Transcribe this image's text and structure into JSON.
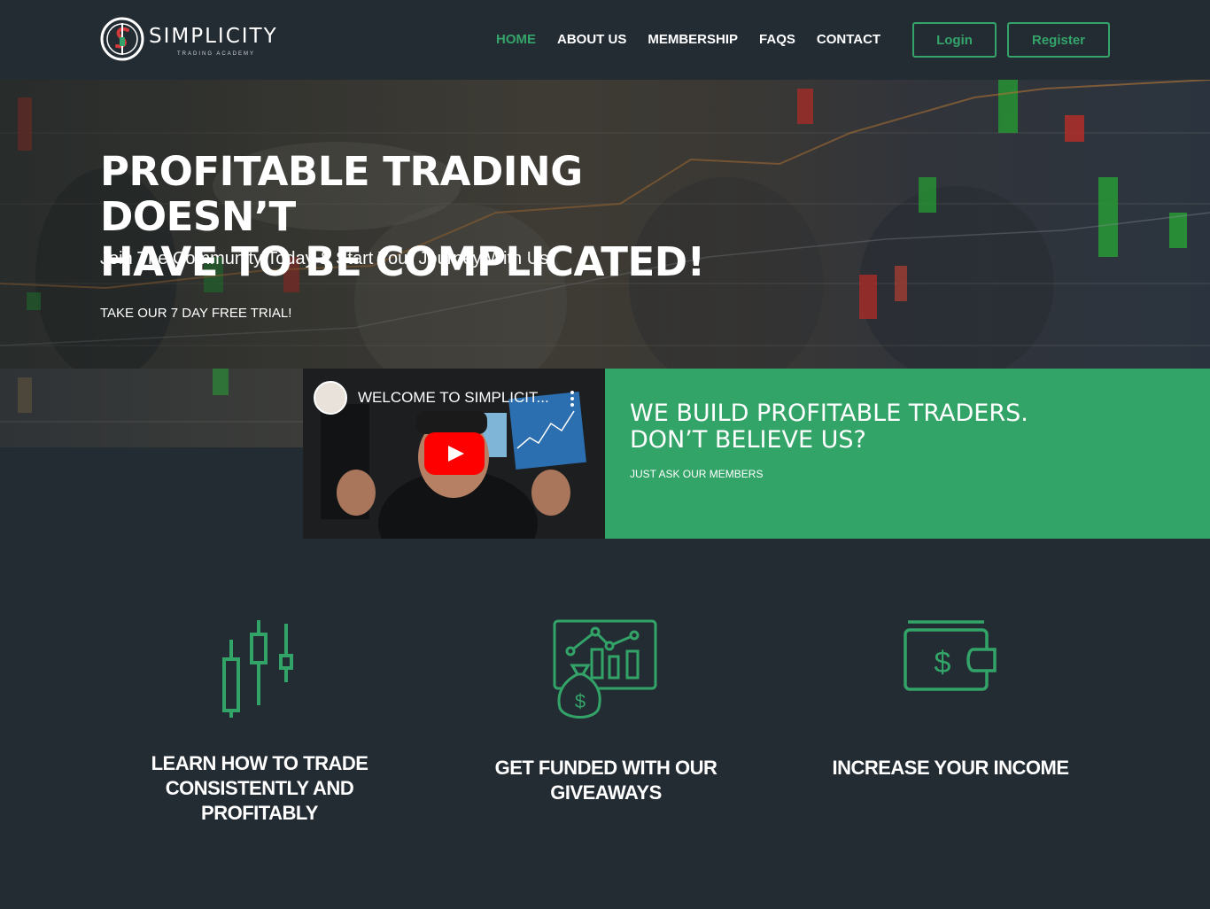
{
  "header": {
    "logo": {
      "word": "SIMPLICITY",
      "tagline": "TRADING ACADEMY"
    },
    "nav": [
      {
        "label": "HOME",
        "active": true
      },
      {
        "label": "ABOUT US",
        "active": false
      },
      {
        "label": "MEMBERSHIP",
        "active": false
      },
      {
        "label": "FAQS",
        "active": false
      },
      {
        "label": "CONTACT",
        "active": false
      }
    ],
    "login_label": "Login",
    "register_label": "Register"
  },
  "hero": {
    "title_line1": "PROFITABLE TRADING DOESN’T",
    "title_line2": "HAVE TO BE COMPLICATED!",
    "subtitle": "Join The Community Today & Start Your Journey With Us!",
    "cta": "TAKE OUR 7 DAY FREE TRIAL!"
  },
  "video": {
    "title": "WELCOME TO SIMPLICIT...",
    "play_icon": "youtube-play-icon"
  },
  "promo": {
    "title_line1": "WE BUILD PROFITABLE TRADERS.",
    "title_line2": "DON’T BELIEVE US?",
    "subtitle": "JUST ASK OUR MEMBERS"
  },
  "features": [
    {
      "icon": "candlestick-icon",
      "label_line1": "LEARN HOW TO TRADE",
      "label_line2": "CONSISTENTLY AND",
      "label_line3": "PROFITABLY"
    },
    {
      "icon": "money-bag-chart-icon",
      "label_line1": "GET FUNDED WITH OUR",
      "label_line2": "GIVEAWAYS"
    },
    {
      "icon": "wallet-icon",
      "label_line1": "INCREASE YOUR INCOME"
    }
  ],
  "colors": {
    "background": "#232b33",
    "accent": "#33a468",
    "text": "#ffffff"
  }
}
